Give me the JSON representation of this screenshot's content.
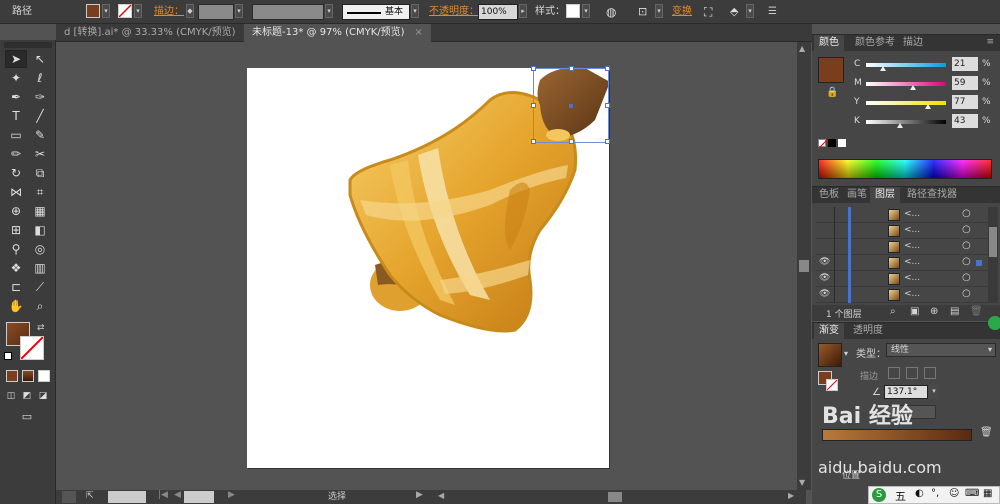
{
  "control_bar": {
    "path_label": "路径",
    "stroke_label": "描边：",
    "stroke_style": "基本",
    "opacity_label": "不透明度：",
    "opacity_value": "100%",
    "style_label": "样式：",
    "transform_label": "变换"
  },
  "document_tabs": [
    {
      "label": "d [转换].ai* @ 33.33% (CMYK/预览)",
      "active": false
    },
    {
      "label": "未标题-13* @ 97% (CMYK/预览)",
      "active": true
    }
  ],
  "color_panel": {
    "tabs": [
      "颜色",
      "颜色参考",
      "描边"
    ],
    "fill_color": "#7a3e1e",
    "sliders": [
      {
        "label": "C",
        "value": "21",
        "colors": [
          "#ffffff",
          "#00a0e0"
        ]
      },
      {
        "label": "M",
        "value": "59",
        "colors": [
          "#ffffff",
          "#e0007a"
        ]
      },
      {
        "label": "Y",
        "value": "77",
        "colors": [
          "#ffffff",
          "#f0e000"
        ]
      },
      {
        "label": "K",
        "value": "43",
        "colors": [
          "#ffffff",
          "#000000"
        ]
      }
    ],
    "percent_sign": "%"
  },
  "layers_panel": {
    "tabs": [
      "色板",
      "画笔",
      "图层",
      "路径查找器"
    ],
    "rows": [
      {
        "name": "<...",
        "visible": false
      },
      {
        "name": "<...",
        "visible": false
      },
      {
        "name": "<...",
        "visible": false
      },
      {
        "name": "<...",
        "visible": true
      },
      {
        "name": "<...",
        "visible": true
      },
      {
        "name": "<...",
        "visible": true
      }
    ],
    "footer": "1 个图层"
  },
  "gradient_panel": {
    "tabs": [
      "渐变",
      "透明度"
    ],
    "type_label": "类型：",
    "type_value": "线性",
    "stroke_label": "描边",
    "angle_value": "137.1°",
    "position_label": "位置"
  },
  "status_bar": {
    "mode": "选择"
  },
  "watermark": {
    "brand": "Bai 经验",
    "url": "aidu.baidu.com"
  },
  "ime_bar": {
    "text": "五"
  },
  "colors": {
    "bell_gold": "#e8a52a",
    "bell_light": "#f7d27a",
    "handle_brown": "#7a4b22",
    "ui_orange": "#e08a2a"
  }
}
